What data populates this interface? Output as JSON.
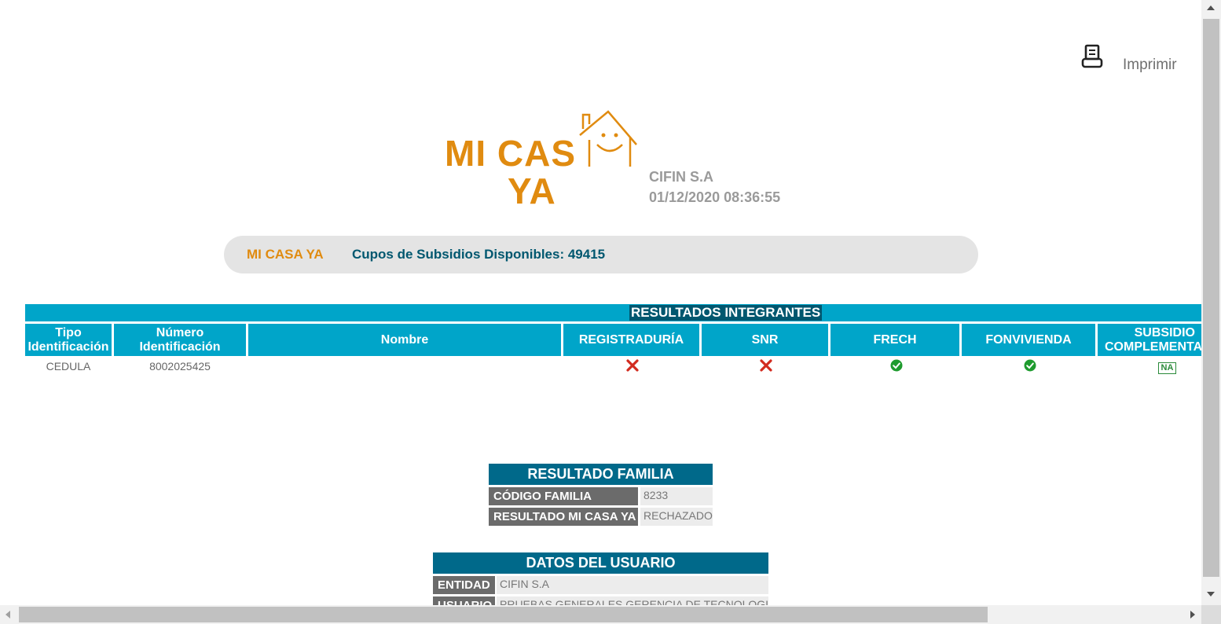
{
  "toolbar": {
    "print_label": "Imprimir",
    "print_icon": "printer-icon"
  },
  "logo": {
    "line1": "MI CAS",
    "line2": "YA",
    "color": "#e08b10"
  },
  "header": {
    "entity": "CIFIN S.A",
    "datetime": "01/12/2020 08:36:55"
  },
  "banner": {
    "program": "MI CASA YA",
    "cupos": "Cupos de Subsidios Disponibles: 49415"
  },
  "results": {
    "title": "RESULTADOS INTEGRANTES",
    "columns": [
      "Tipo Identificación",
      "Número Identificación",
      "Nombre",
      "REGISTRADURÍA",
      "SNR",
      "FRECH",
      "FONVIVIENDA",
      "SUBSIDIO COMPLEMENTARIO"
    ],
    "rows": [
      {
        "tipo": "CEDULA",
        "numero": "8002025425",
        "nombre": "",
        "registraduria": "x-icon",
        "snr": "x-icon",
        "frech": "check-icon",
        "fonvivienda": "check-icon",
        "subsidio": "NA"
      }
    ]
  },
  "familia": {
    "title": "RESULTADO FAMILIA",
    "codigo_label": "CÓDIGO FAMILIA",
    "codigo": "8233",
    "resultado_label": "RESULTADO MI CASA YA",
    "resultado": "RECHAZADO"
  },
  "usuario": {
    "title": "DATOS DEL USUARIO",
    "entidad_label": "ENTIDAD",
    "entidad": "CIFIN S.A",
    "usuario_label": "USUARIO",
    "usuario": "PRUEBAS GENERALES GERENCIA DE TECNOLOGIA"
  },
  "colors": {
    "accent": "#00a5c9",
    "dark_accent": "#00576f",
    "orange": "#e08b10",
    "reject": "#d22b1f",
    "approve": "#1e9b2e"
  }
}
